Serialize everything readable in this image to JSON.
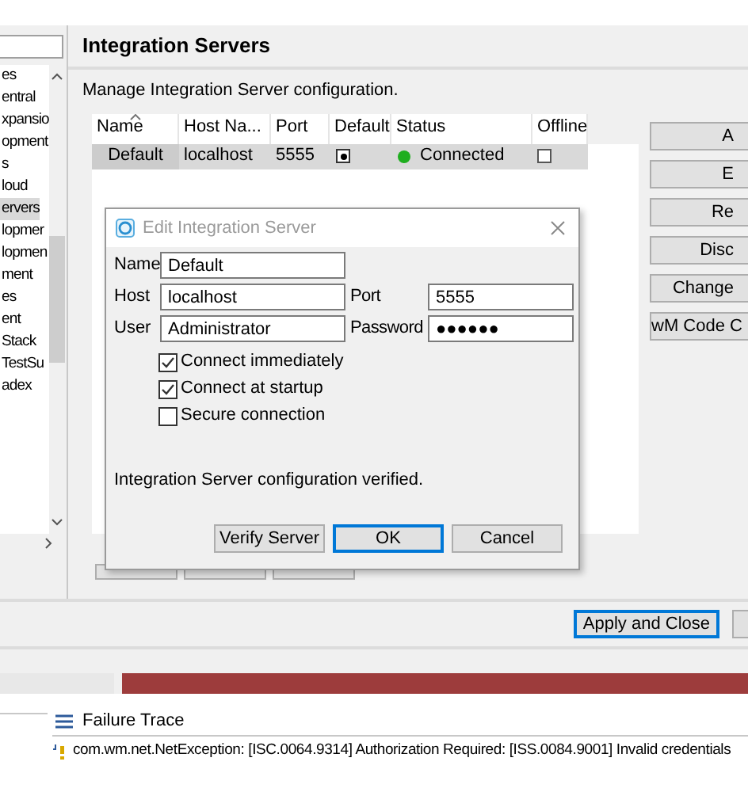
{
  "tree": {
    "items": [
      {
        "label": "es",
        "selected": false
      },
      {
        "label": "entral",
        "selected": false
      },
      {
        "label": "xpansio",
        "selected": false
      },
      {
        "label": "opment",
        "selected": false
      },
      {
        "label": "s",
        "selected": false
      },
      {
        "label": "loud",
        "selected": false
      },
      {
        "label": "ervers",
        "selected": true
      },
      {
        "label": "lopmer",
        "selected": false
      },
      {
        "label": "lopmen",
        "selected": false
      },
      {
        "label": "ment",
        "selected": false
      },
      {
        "label": "es",
        "selected": false
      },
      {
        "label": "ent",
        "selected": false
      },
      {
        "label": "Stack",
        "selected": false
      },
      {
        "label": "TestSu",
        "selected": false
      },
      {
        "label": "adex",
        "selected": false
      }
    ]
  },
  "page": {
    "title": "Integration Servers",
    "description": "Manage Integration Server configuration."
  },
  "table": {
    "columns": [
      {
        "label": "Name",
        "sorted": true
      },
      {
        "label": "Host Na...",
        "sorted": false
      },
      {
        "label": "Port",
        "sorted": false
      },
      {
        "label": "Default",
        "sorted": false
      },
      {
        "label": "Status",
        "sorted": false
      },
      {
        "label": "Offline",
        "sorted": false
      }
    ],
    "rows": [
      {
        "name": "Default",
        "host": "localhost",
        "port": "5555",
        "default": true,
        "status": "Connected",
        "color": "#1fae1f",
        "offline": false
      }
    ]
  },
  "side_buttons": [
    "A",
    "E",
    "Re",
    "Disc",
    "Change",
    "wM Code C"
  ],
  "dialog": {
    "title": "Edit Integration Server",
    "rows": [
      [
        {
          "label": "Name",
          "value": "Default"
        }
      ],
      [
        {
          "label": "Host",
          "value": "localhost"
        },
        {
          "label": "Port",
          "value": "5555"
        }
      ],
      [
        {
          "label": "User",
          "value": "Administrator"
        },
        {
          "label": "Password",
          "value": "●●●●●●"
        }
      ]
    ],
    "checkboxes": [
      {
        "label": "Connect immediately",
        "checked": true
      },
      {
        "label": "Connect at startup",
        "checked": true
      },
      {
        "label": "Secure connection",
        "checked": false
      }
    ],
    "message": "Integration Server configuration verified.",
    "buttons": [
      {
        "label": "Verify Server",
        "default": false
      },
      {
        "label": "OK",
        "default": true
      },
      {
        "label": "Cancel",
        "default": false
      }
    ]
  },
  "footer_buttons": [
    {
      "label": "Apply and Close",
      "default": true
    }
  ],
  "failure_trace": {
    "title": "Failure Trace",
    "lines": [
      "com.wm.net.NetException: [ISC.0064.9314] Authorization Required: [ISS.0084.9001] Invalid credentials"
    ]
  }
}
